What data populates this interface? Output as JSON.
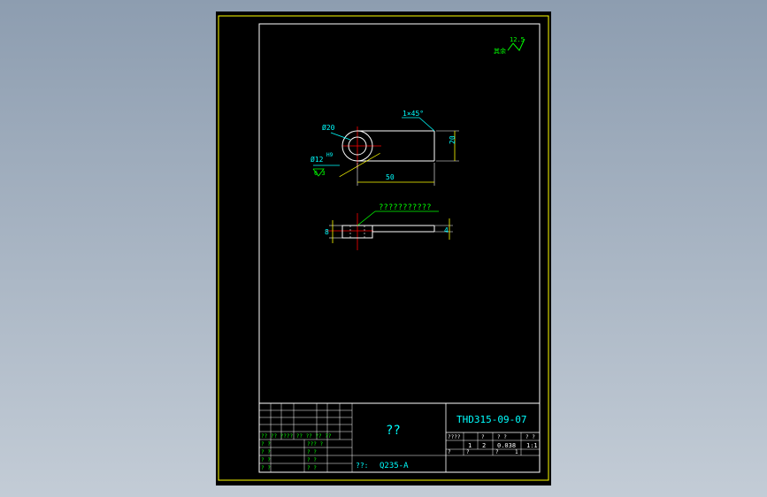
{
  "colors": {
    "background_top": "#8d9db0",
    "background_bottom": "#c3ccd6",
    "canvas": "#000000",
    "frame": "#ffff00",
    "border": "#ffffff",
    "dimension": "#00ffff",
    "annotation": "#00ff00",
    "centerline": "#ff0000",
    "title_text": "#00ffff"
  },
  "drawing": {
    "roughness_value": "12.5",
    "roughness_note": "其余",
    "top_view": {
      "dim_outer_dia": "Ø20",
      "dim_bore_dia": "Ø12",
      "dim_bore_tol": "H9",
      "bore_roughness": "6.3",
      "dim_chamfer": "1×45°",
      "dim_width": "20",
      "dim_length": "50"
    },
    "front_view": {
      "leader_note": "???????????",
      "dim_left": "8",
      "dim_right": "4"
    }
  },
  "title_block": {
    "part_name": "??",
    "drawing_number": "THD315-09-07",
    "material_label": "??:",
    "material": "Q235-A",
    "quantity": "1",
    "count": "2",
    "weight": "0.038",
    "scale": "1:1",
    "sheet_label": "?",
    "sheet_total": "1"
  }
}
